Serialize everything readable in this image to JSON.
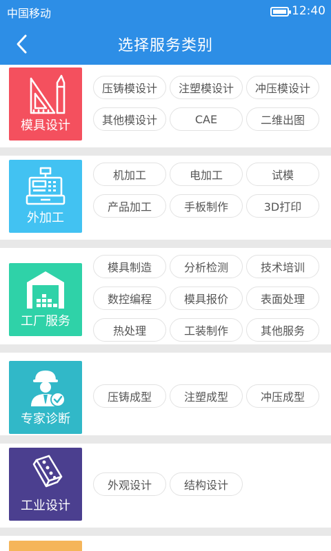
{
  "status_bar": {
    "carrier": "中国移动",
    "time": "12:40"
  },
  "header": {
    "title": "选择服务类别",
    "back_icon": "chevron-left-icon"
  },
  "colors": {
    "primary": "#2d8ee6",
    "separator": "#e8e8e8",
    "chip_border": "#e2e2e2",
    "chip_text": "#555555"
  },
  "categories": [
    {
      "label": "模具设计",
      "color": "#f4505e",
      "icon": "drafting-tools-icon",
      "services": [
        "压铸模设计",
        "注塑模设计",
        "冲压模设计",
        "其他模设计",
        "CAE",
        "二维出图"
      ]
    },
    {
      "label": "外加工",
      "color": "#42c2f2",
      "icon": "cash-register-icon",
      "services": [
        "机加工",
        "电加工",
        "试模",
        "产品加工",
        "手板制作",
        "3D打印"
      ]
    },
    {
      "label": "工厂服务",
      "color": "#2fd2a8",
      "icon": "factory-warehouse-icon",
      "services": [
        "模具制造",
        "分析检测",
        "技术培训",
        "数控编程",
        "模具报价",
        "表面处理",
        "热处理",
        "工装制作",
        "其他服务"
      ]
    },
    {
      "label": "专家诊断",
      "color": "#31b8c8",
      "icon": "expert-engineer-icon",
      "services": [
        "压铸成型",
        "注塑成型",
        "冲压成型"
      ]
    },
    {
      "label": "工业设计",
      "color": "#4b3f8f",
      "icon": "industrial-brick-icon",
      "services": [
        "外观设计",
        "结构设计"
      ]
    }
  ]
}
